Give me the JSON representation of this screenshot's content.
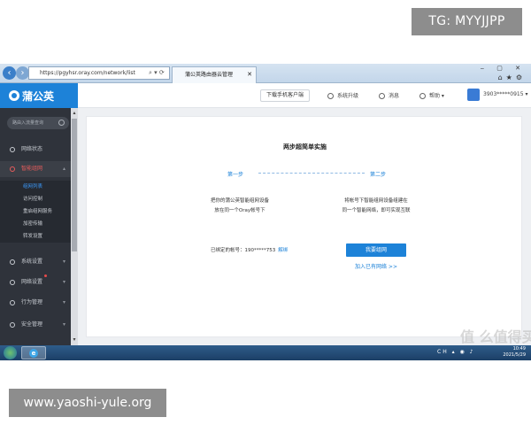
{
  "overlay": {
    "tg_badge": "TG: MYYJJPP",
    "site_badge": "www.yaoshi-yule.org"
  },
  "browser": {
    "url": "https://pgyhsr.oray.com/network/list",
    "tab_title": "蒲公英路由器云管理",
    "back_icon": "back-arrow-icon",
    "forward_icon": "forward-arrow-icon"
  },
  "header": {
    "logo_text": "蒲公英",
    "download_button": "下载手机客户端",
    "system_upgrade": "系统升级",
    "messages": "消息",
    "help": "帮助",
    "account": "3903*****0915"
  },
  "sidebar": {
    "search_placeholder": "路由入流量查询",
    "items": [
      {
        "label": "网络状态"
      },
      {
        "label": "智能组网",
        "active": true
      },
      {
        "label": "系统设置"
      },
      {
        "label": "网络设置",
        "badge": true
      },
      {
        "label": "行为管理"
      },
      {
        "label": "安全管理"
      }
    ],
    "sub_items": [
      {
        "label": "组网列表",
        "current": true
      },
      {
        "label": "访问控制"
      },
      {
        "label": "重启组网服务"
      },
      {
        "label": "加密传输"
      },
      {
        "label": "转发设置"
      }
    ]
  },
  "main": {
    "title": "两步超简单实施",
    "step1": "第一步",
    "step2": "第二步",
    "step1_line1": "把你的蒲公英智能组网设备",
    "step1_line2": "放在同一个Oray帐号下",
    "step2_line1": "将帐号下智能组网设备组建在",
    "step2_line2": "同一个智能网络，即可实现互联",
    "bound_label": "已绑定的帐号：",
    "bound_account": "190*****753",
    "bound_link": "解绑",
    "primary_button": "我要组网",
    "join_link": "加入已有网络 >>"
  },
  "watermark": "值 么值得买",
  "taskbar": {
    "time": "10:49",
    "date": "2021/5/29",
    "lang": "CH"
  }
}
